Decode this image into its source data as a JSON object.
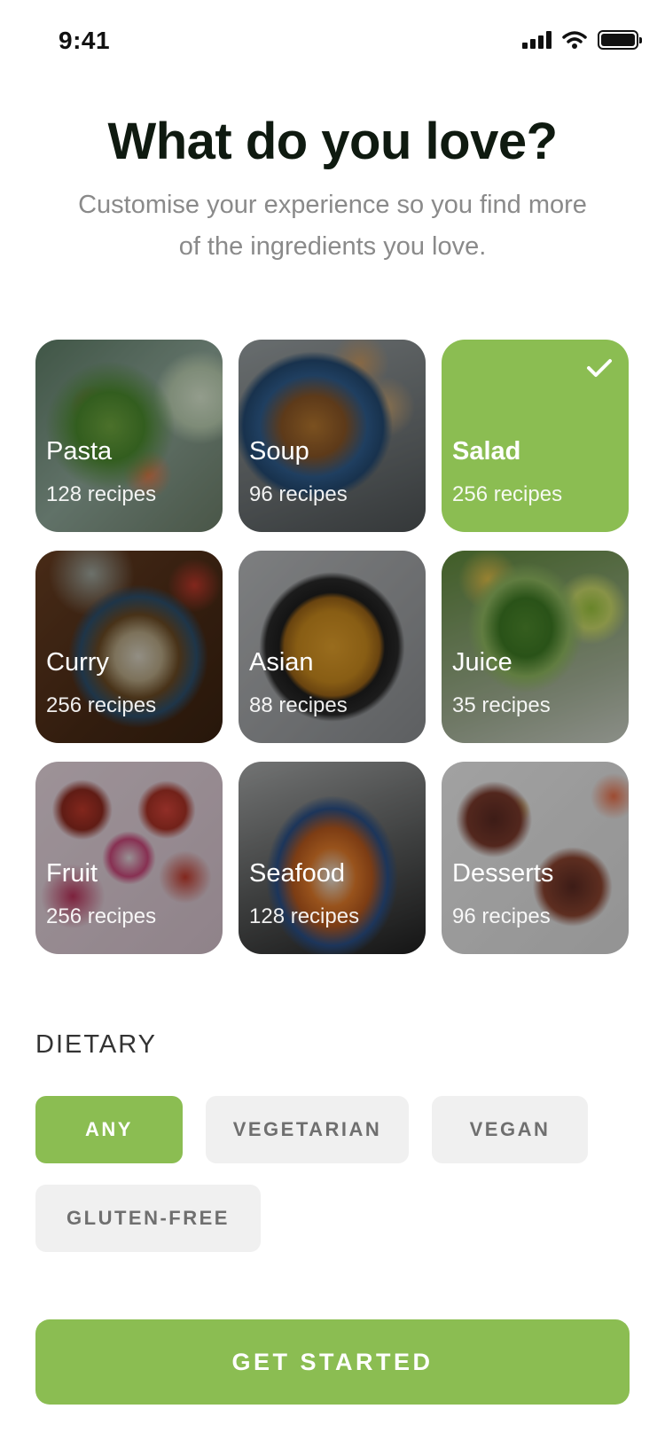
{
  "status_bar": {
    "time": "9:41"
  },
  "header": {
    "title": "What do you love?",
    "subtitle": "Customise your experience so you find more of the ingredients you love."
  },
  "categories": [
    {
      "label": "Pasta",
      "count": "128 recipes",
      "selected": false
    },
    {
      "label": "Soup",
      "count": "96 recipes",
      "selected": false
    },
    {
      "label": "Salad",
      "count": "256 recipes",
      "selected": true
    },
    {
      "label": "Curry",
      "count": "256 recipes",
      "selected": false
    },
    {
      "label": "Asian",
      "count": "88 recipes",
      "selected": false
    },
    {
      "label": "Juice",
      "count": "35 recipes",
      "selected": false
    },
    {
      "label": "Fruit",
      "count": "256 recipes",
      "selected": false
    },
    {
      "label": "Seafood",
      "count": "128 recipes",
      "selected": false
    },
    {
      "label": "Desserts",
      "count": "96 recipes",
      "selected": false
    }
  ],
  "dietary": {
    "title": "DIETARY",
    "options": [
      {
        "label": "ANY",
        "selected": true
      },
      {
        "label": "VEGETARIAN",
        "selected": false
      },
      {
        "label": "VEGAN",
        "selected": false
      },
      {
        "label": "GLUTEN-FREE",
        "selected": false
      }
    ]
  },
  "cta": {
    "label": "GET STARTED"
  },
  "colors": {
    "accent": "#8bbd52",
    "chip_bg": "#f0f0f0",
    "chip_text": "#6f6f6f",
    "subtitle": "#8a8a8a"
  }
}
